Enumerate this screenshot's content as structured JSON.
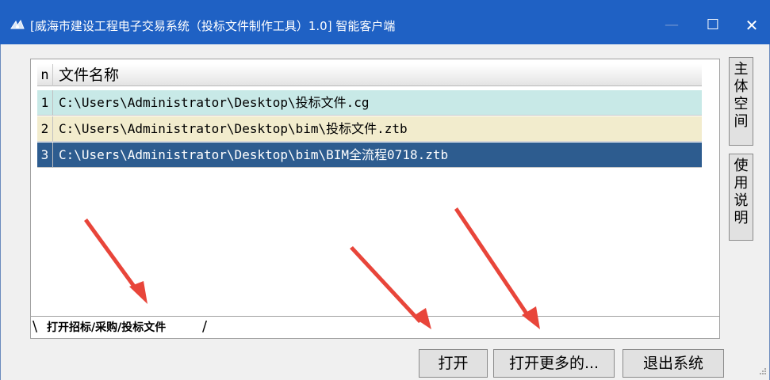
{
  "window": {
    "title": "[威海市建设工程电子交易系统（投标文件制作工具）1.0] 智能客户端",
    "minimize_glyph": "—",
    "maximize_glyph": "☐",
    "close_glyph": "✕"
  },
  "file_list": {
    "header": {
      "n": "n",
      "name": "文件名称"
    },
    "rows": [
      {
        "index": "1",
        "path": "C:\\Users\\Administrator\\Desktop\\投标文件.cg"
      },
      {
        "index": "2",
        "path": "C:\\Users\\Administrator\\Desktop\\bim\\投标文件.ztb"
      },
      {
        "index": "3",
        "path": "C:\\Users\\Administrator\\Desktop\\bim\\BIM全流程0718.ztb"
      }
    ]
  },
  "tabs": [
    {
      "label": "打开招标/采购/投标文件"
    }
  ],
  "side_buttons": {
    "main_space": [
      "主",
      "体",
      "空",
      "间"
    ],
    "manual": [
      "使",
      "用",
      "说",
      "明"
    ]
  },
  "buttons": {
    "open": "打开",
    "open_more": "打开更多的...",
    "exit": "退出系统"
  },
  "colors": {
    "titlebar": "#1f61c4",
    "row1": "#c8e9e7",
    "row2": "#f2eccd",
    "row_selected": "#2d5c8f",
    "arrow": "#e8453a"
  },
  "icons": [
    "app-icon",
    "minimize-icon",
    "maximize-icon",
    "close-icon",
    "resize-grip-icon",
    "annotation-arrow"
  ]
}
